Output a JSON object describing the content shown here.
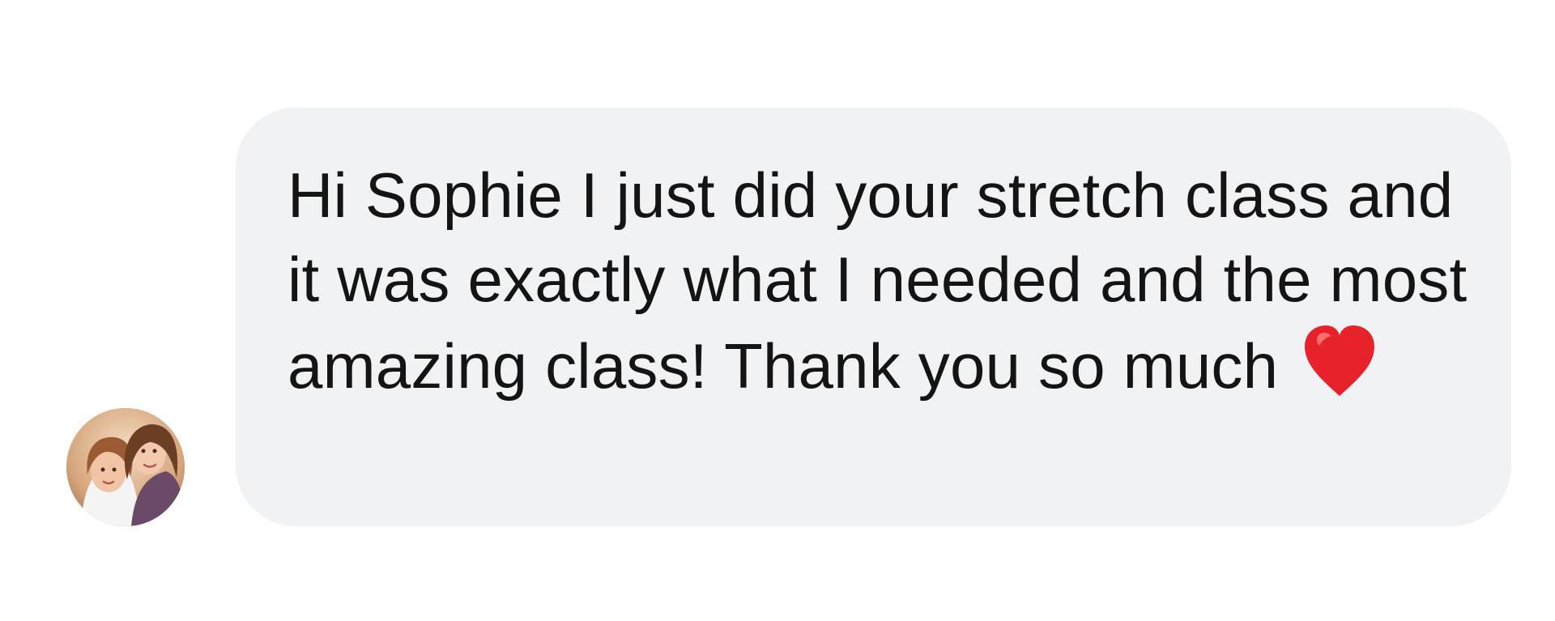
{
  "message": {
    "text": "Hi Sophie I just did your stretch class and it was exactly what I needed and the most amazing class! Thank you so much",
    "emoji_icon": "red-heart-icon"
  },
  "colors": {
    "bubble_background": "#f1f2f4",
    "text": "#141414",
    "heart": "#e8222a",
    "page_background": "#ffffff"
  },
  "avatar": {
    "icon": "profile-photo-two-people"
  }
}
